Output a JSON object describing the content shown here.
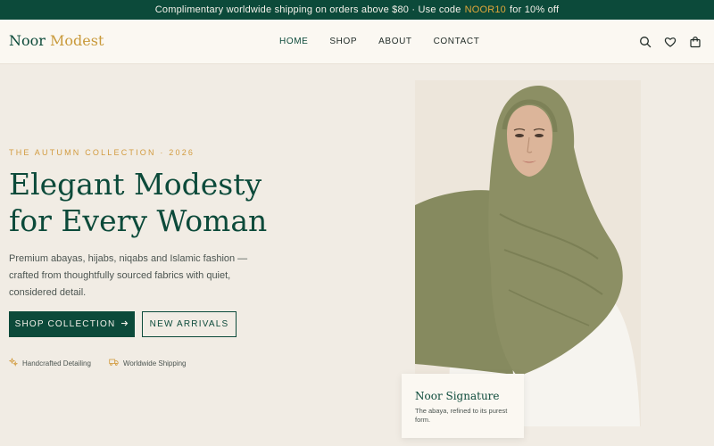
{
  "announcement": {
    "before": "Complimentary worldwide shipping on orders above $80 · Use code",
    "code": "NOOR10",
    "after": "for 10% off"
  },
  "brand": {
    "part1": "Noor",
    "part2": "Modest"
  },
  "nav": [
    {
      "label": "HOME",
      "active": true
    },
    {
      "label": "SHOP"
    },
    {
      "label": "ABOUT"
    },
    {
      "label": "CONTACT"
    }
  ],
  "header_icons": [
    "search-icon",
    "heart-icon",
    "bag-icon"
  ],
  "hero": {
    "eyebrow": "THE AUTUMN COLLECTION · 2026",
    "headline_line1": "Elegant Modesty",
    "headline_line2": "for Every Woman",
    "description": "Premium abayas, hijabs, niqabs and Islamic fashion — crafted from thoughtfully sourced fabrics with quiet, considered detail.",
    "primary_cta": "SHOP COLLECTION",
    "secondary_cta": "NEW ARRIVALS",
    "features": [
      {
        "icon": "sparkle-icon",
        "label": "Handcrafted Detailing"
      },
      {
        "icon": "truck-icon",
        "label": "Worldwide Shipping"
      }
    ]
  },
  "card": {
    "title": "Noor Signature",
    "text": "The abaya, refined to its purest form."
  },
  "colors": {
    "brand_green": "#0c4a3a",
    "accent_gold": "#d29b3f",
    "background": "#f1ece4",
    "hijab_olive": "#8c8f64"
  }
}
